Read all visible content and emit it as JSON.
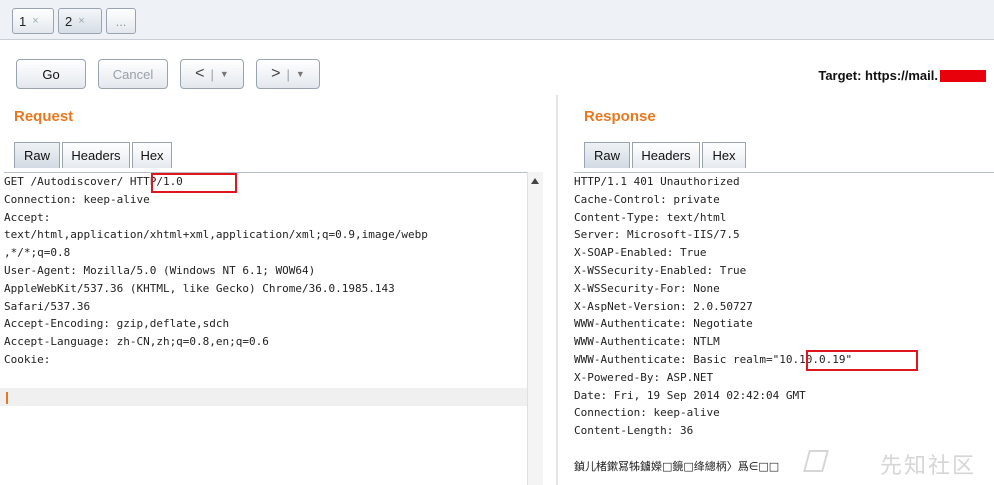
{
  "tabs": [
    {
      "label": "1",
      "close": "×"
    },
    {
      "label": "2",
      "close": "×"
    },
    {
      "label": "..."
    }
  ],
  "toolbar": {
    "go_label": "Go",
    "cancel_label": "Cancel",
    "back_label": "<",
    "forward_label": ">",
    "dropdown_glyph": "▼",
    "target_label": "Target: https://mail."
  },
  "request": {
    "title": "Request",
    "tabs": [
      "Raw",
      "Headers",
      "Hex"
    ],
    "lines": [
      "GET /Autodiscover/ HTTP/1.0",
      "Connection: keep-alive",
      "Accept:",
      "text/html,application/xhtml+xml,application/xml;q=0.9,image/webp",
      ",*/*;q=0.8",
      "User-Agent: Mozilla/5.0 (Windows NT 6.1; WOW64)",
      "AppleWebKit/537.36 (KHTML, like Gecko) Chrome/36.0.1985.143",
      "Safari/537.36",
      "Accept-Encoding: gzip,deflate,sdch",
      "Accept-Language: zh-CN,zh;q=0.8,en;q=0.6",
      "Cookie:"
    ]
  },
  "response": {
    "title": "Response",
    "tabs": [
      "Raw",
      "Headers",
      "Hex"
    ],
    "lines": [
      "HTTP/1.1 401 Unauthorized",
      "Cache-Control: private",
      "Content-Type: text/html",
      "Server: Microsoft-IIS/7.5",
      "X-SOAP-Enabled: True",
      "X-WSSecurity-Enabled: True",
      "X-WSSecurity-For: None",
      "X-AspNet-Version: 2.0.50727",
      "WWW-Authenticate: Negotiate",
      "WWW-Authenticate: NTLM",
      "WWW-Authenticate: Basic realm=\"10.10.0.19\"",
      "X-Powered-By: ASP.NET",
      "Date: Fri, 19 Sep 2014 02:42:04 GMT",
      "Connection: keep-alive",
      "Content-Length: 36",
      "",
      "鍞儿楮鏉冩牬鐪嬫□鏡□绛總柄〉爲∈□□"
    ]
  },
  "watermark": "先知社区",
  "colors": {
    "accent": "#e8781e",
    "highlight": "#e0161e",
    "redaction": "#e8000a"
  }
}
